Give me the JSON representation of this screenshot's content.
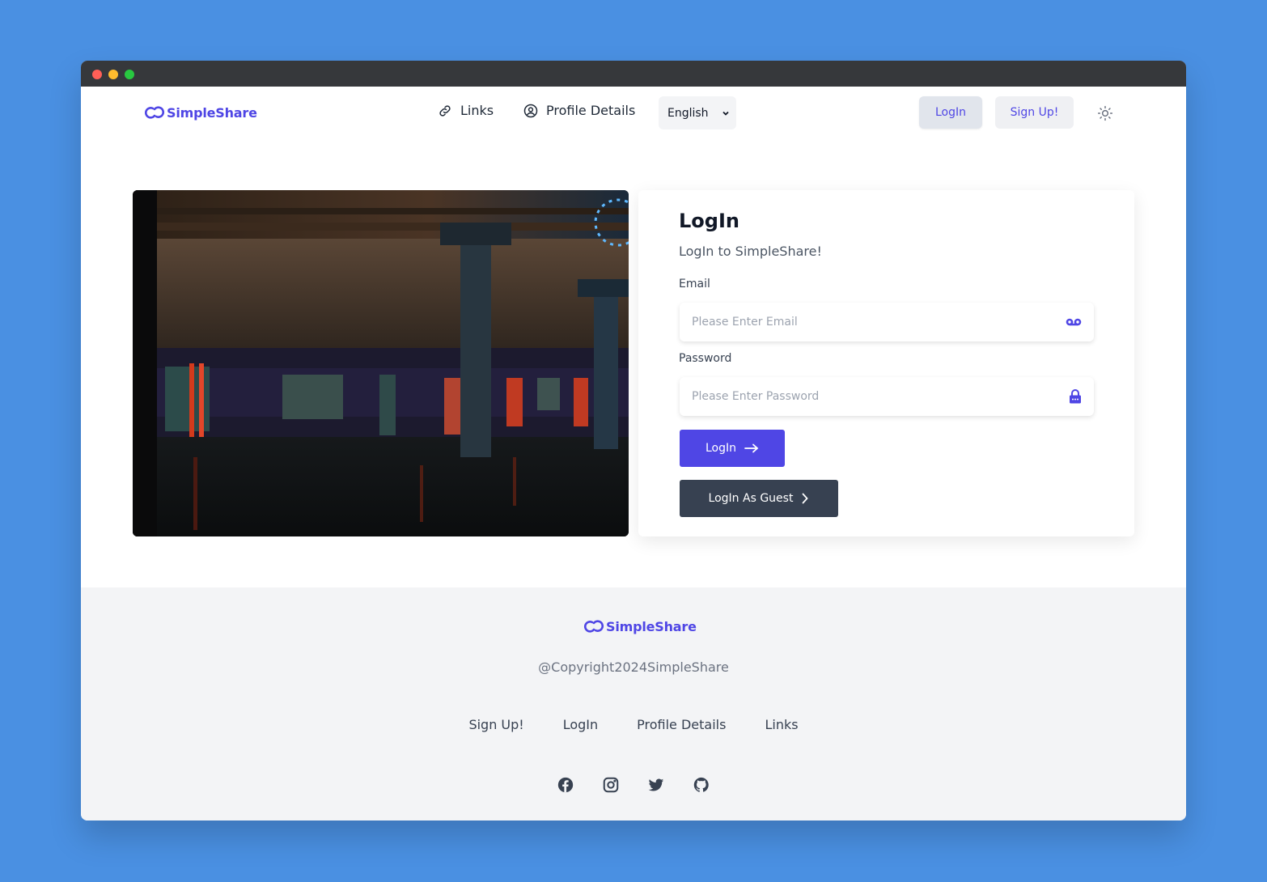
{
  "brand": {
    "name": "SimpleShare",
    "color": "#4f46e5"
  },
  "header": {
    "nav": {
      "links_label": "Links",
      "profile_label": "Profile Details"
    },
    "language": {
      "selected": "English"
    },
    "login_label": "LogIn",
    "signup_label": "Sign Up!"
  },
  "card": {
    "title": "LogIn",
    "subtitle": "LogIn to SimpleShare!",
    "email": {
      "label": "Email",
      "placeholder": "Please Enter Email",
      "value": ""
    },
    "password": {
      "label": "Password",
      "placeholder": "Please Enter Password",
      "value": ""
    },
    "login_button": "LogIn",
    "guest_button": "LogIn As Guest"
  },
  "footer": {
    "copyright": "@Copyright2024SimpleShare",
    "links": [
      "Sign Up!",
      "LogIn",
      "Profile Details",
      "Links"
    ],
    "socials": [
      "facebook-icon",
      "instagram-icon",
      "twitter-icon",
      "github-icon"
    ]
  }
}
